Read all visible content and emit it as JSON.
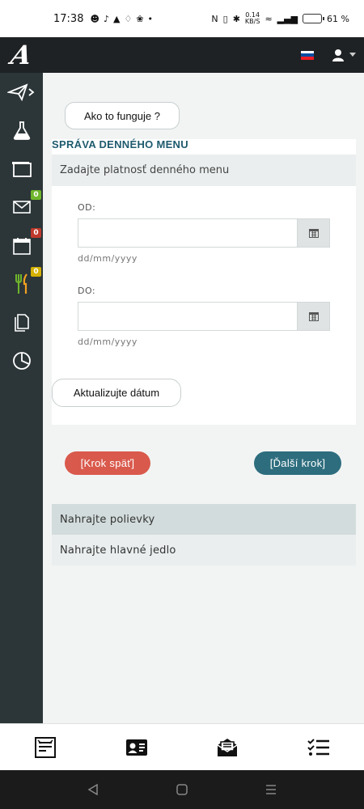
{
  "status_bar": {
    "time": "17:38",
    "net_speed": "0.14",
    "net_unit": "KB/S",
    "battery_percent": "61 %",
    "battery_level": 0.61
  },
  "app_bar": {
    "logo_text": "A",
    "flag_colors": [
      "#ffffff",
      "#0b4ea2",
      "#ee1c25"
    ]
  },
  "sidebar": {
    "items": [
      {
        "name": "send-icon"
      },
      {
        "name": "flask-icon"
      },
      {
        "name": "window-icon"
      },
      {
        "name": "envelope-icon",
        "badge": "0",
        "badge_color": "#6fb52c"
      },
      {
        "name": "calendar-icon",
        "badge": "0",
        "badge_color": "#c0392b"
      },
      {
        "name": "cutlery-icon",
        "badge": "0",
        "badge_color": "#d4b000"
      },
      {
        "name": "documents-icon"
      },
      {
        "name": "pie-chart-icon"
      }
    ]
  },
  "main": {
    "how_it_works": "Ako to funguje ?",
    "section_title": "SPRÁVA DENNÉHO MENU",
    "section_subtitle": "Zadajte platnosť denného menu",
    "from_label": "OD:",
    "from_value": "",
    "from_hint": "dd/mm/yyyy",
    "to_label": "DO:",
    "to_value": "",
    "to_hint": "dd/mm/yyyy",
    "update_button": "Aktualizujte dátum",
    "prev_button": "[Krok späť]",
    "next_button": "[Ďalší krok]",
    "steps": [
      {
        "label": "Nahrajte polievky",
        "active": true
      },
      {
        "label": "Nahrajte hlavné jedlo",
        "active": false
      }
    ]
  },
  "colors": {
    "accent": "#1e5a6e",
    "prev": "#d9594c",
    "next": "#2d6d7e",
    "sidebar": "#2c3638",
    "appbar": "#1f2224",
    "active_step": "#d3dcdc",
    "inactive_step": "#eaeeee"
  },
  "bottom_nav": [
    {
      "name": "menu-list-icon"
    },
    {
      "name": "id-card-icon"
    },
    {
      "name": "open-mail-icon"
    },
    {
      "name": "checklist-icon"
    }
  ]
}
